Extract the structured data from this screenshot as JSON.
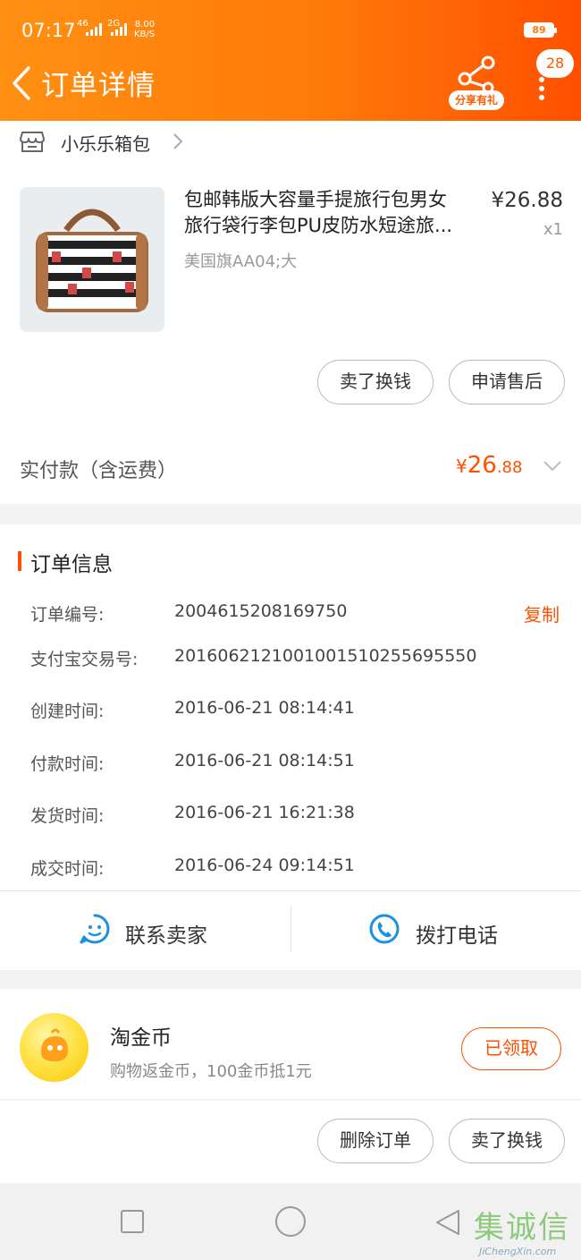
{
  "status_bar": {
    "time": "07:17",
    "signal1_tag": "46",
    "signal2_tag": "2G",
    "net_speed": "8.00",
    "net_unit": "KB/S",
    "battery": "89"
  },
  "header": {
    "title": "订单详情",
    "share_label": "分享有礼",
    "badge_count": "28",
    "back_icon": "chevron-left-icon",
    "share_icon": "share-icon",
    "more_icon": "more-vertical-icon"
  },
  "shop": {
    "name": "小乐乐箱包",
    "icon": "store-icon"
  },
  "product": {
    "title_line1": "包邮韩版大容量手提旅行包男女",
    "title_line2": "旅行袋行李包PU皮防水短途旅...",
    "spec": "美国旗AA04;大",
    "price": "¥26.88",
    "quantity": "x1"
  },
  "product_actions": {
    "sell_label": "卖了换钱",
    "aftersale_label": "申请售后"
  },
  "payment": {
    "label": "实付款（含运费）",
    "currency": "¥",
    "amount_int": "26",
    "amount_dec": ".88"
  },
  "order_info": {
    "title": "订单信息",
    "copy_label": "复制",
    "rows": [
      {
        "label": "订单编号:",
        "value": "2004615208169750"
      },
      {
        "label": "支付宝交易号:",
        "value": "2016062121001001510255695550"
      },
      {
        "label": "创建时间:",
        "value": "2016-06-21 08:14:41"
      },
      {
        "label": "付款时间:",
        "value": "2016-06-21 08:14:51"
      },
      {
        "label": "发货时间:",
        "value": "2016-06-21 16:21:38"
      },
      {
        "label": "成交时间:",
        "value": "2016-06-24 09:14:51"
      }
    ]
  },
  "contact": {
    "seller_label": "联系卖家",
    "call_label": "拨打电话"
  },
  "coin": {
    "title": "淘金币",
    "subtitle": "购物返金币，100金币抵1元",
    "status_label": "已领取"
  },
  "bottom_actions": {
    "delete_label": "删除订单",
    "sell_label": "卖了换钱"
  },
  "watermark": {
    "text": "集诚信",
    "url": "JiChengXin.com"
  },
  "colors": {
    "accent": "#ff5000",
    "header_start": "#ff9012",
    "header_end": "#ff5000",
    "icon_blue": "#1e90e0"
  }
}
